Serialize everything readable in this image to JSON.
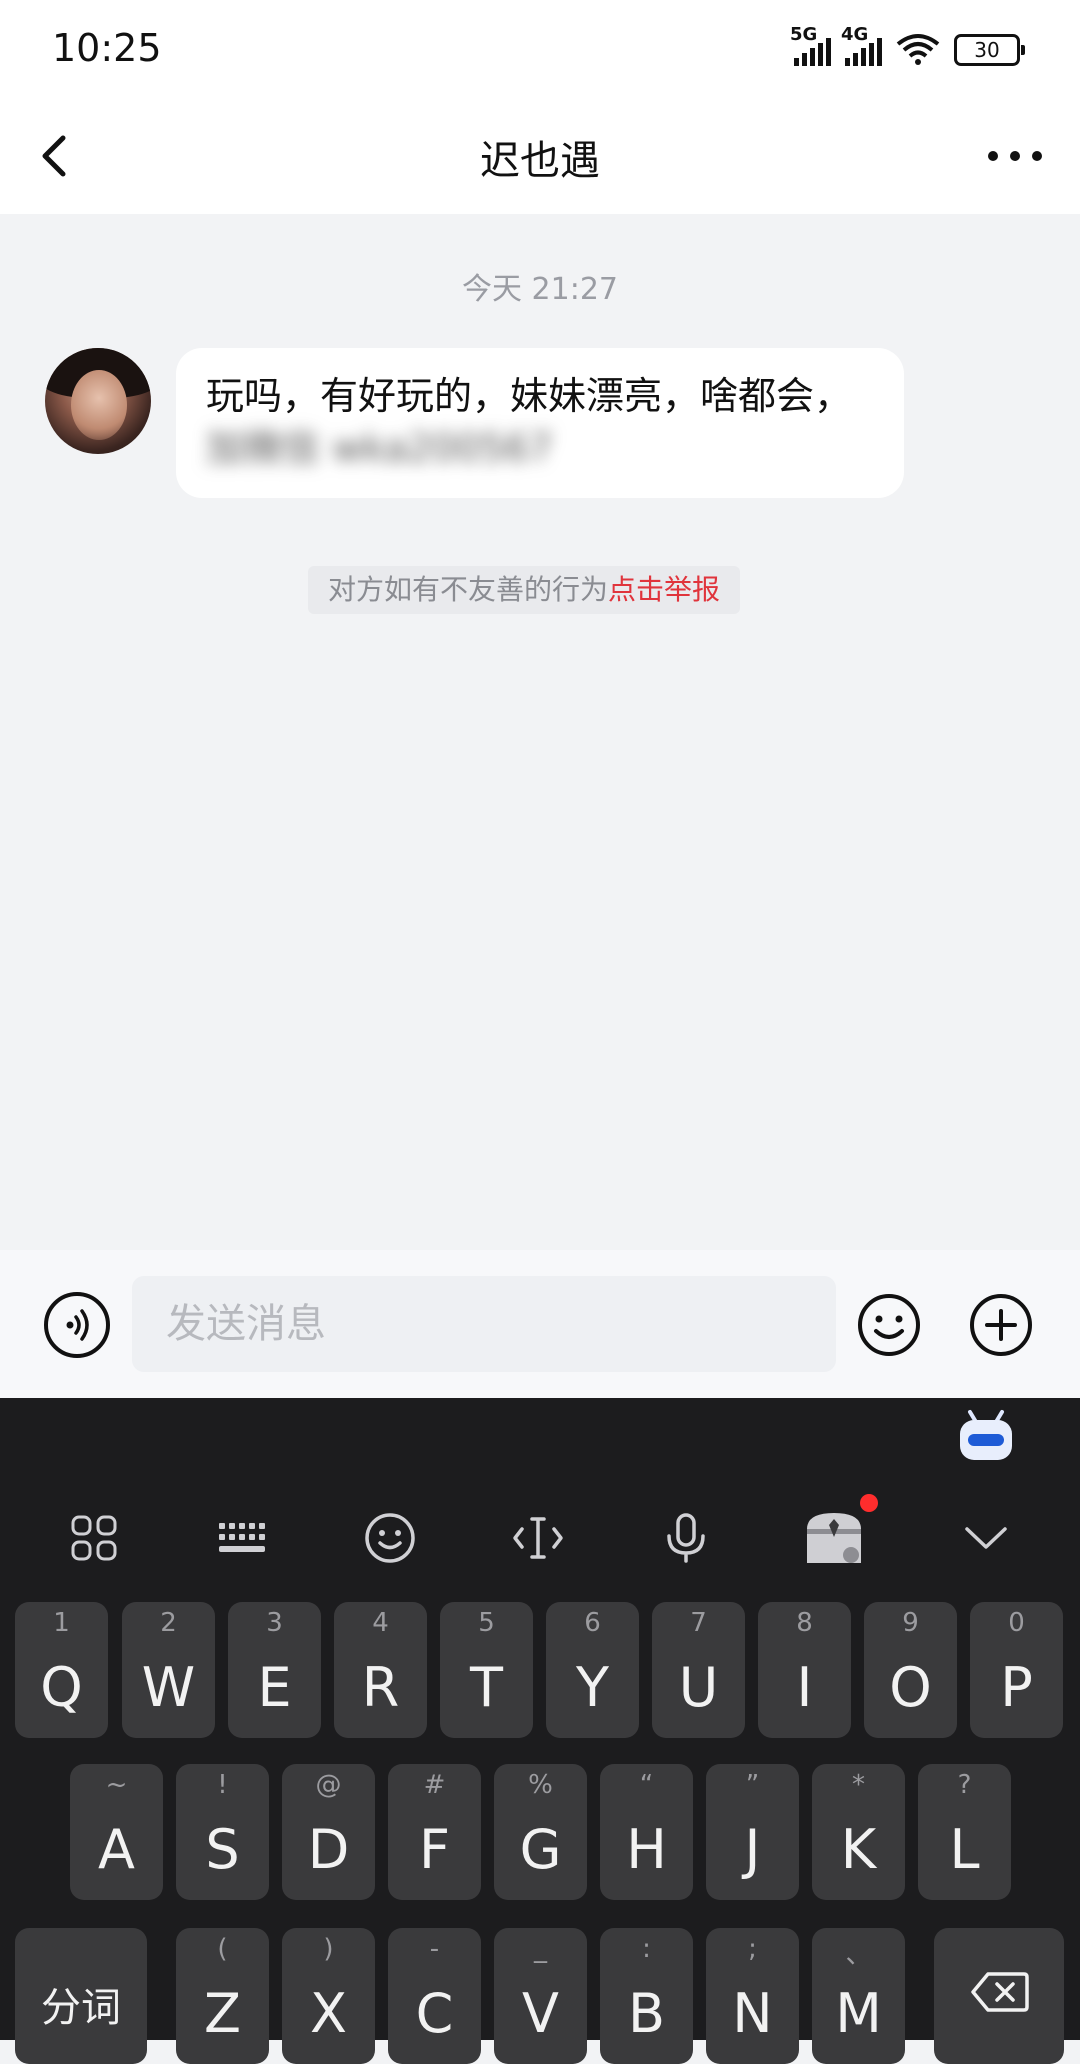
{
  "status_bar": {
    "time": "10:25",
    "network_1": "5G",
    "network_2": "4G",
    "battery": "30"
  },
  "nav": {
    "title": "迟也遇",
    "back_icon": "chevron-left-icon",
    "more_icon": "more-horizontal-icon"
  },
  "chat": {
    "timestamp": "今天 21:27",
    "message_text": "玩吗，有好玩的，妹妹漂亮，啥都会，",
    "message_blurred_part": "加微信 wka200567",
    "report_notice": "对方如有不友善的行为",
    "report_link": "点击举报"
  },
  "input_bar": {
    "placeholder": "发送消息",
    "voice_icon": "voice-icon",
    "emoji_icon": "emoji-icon",
    "plus_icon": "plus-circle-icon"
  },
  "keyboard": {
    "toolbar": [
      "apps-grid-icon",
      "keyboard-icon",
      "emoji-icon",
      "cursor-icon",
      "microphone-icon",
      "treasure-chest-icon",
      "chevron-down-icon"
    ],
    "row1": [
      {
        "main": "Q",
        "sub": "1"
      },
      {
        "main": "W",
        "sub": "2"
      },
      {
        "main": "E",
        "sub": "3"
      },
      {
        "main": "R",
        "sub": "4"
      },
      {
        "main": "T",
        "sub": "5"
      },
      {
        "main": "Y",
        "sub": "6"
      },
      {
        "main": "U",
        "sub": "7"
      },
      {
        "main": "I",
        "sub": "8"
      },
      {
        "main": "O",
        "sub": "9"
      },
      {
        "main": "P",
        "sub": "0"
      }
    ],
    "row2": [
      {
        "main": "A",
        "sub": "~"
      },
      {
        "main": "S",
        "sub": "!"
      },
      {
        "main": "D",
        "sub": "@"
      },
      {
        "main": "F",
        "sub": "#"
      },
      {
        "main": "G",
        "sub": "%"
      },
      {
        "main": "H",
        "sub": "“"
      },
      {
        "main": "J",
        "sub": "”"
      },
      {
        "main": "K",
        "sub": "*"
      },
      {
        "main": "L",
        "sub": "?"
      }
    ],
    "row3_left": "分词",
    "row3": [
      {
        "main": "Z",
        "sub": "("
      },
      {
        "main": "X",
        "sub": ")"
      },
      {
        "main": "C",
        "sub": "-"
      },
      {
        "main": "V",
        "sub": "_"
      },
      {
        "main": "B",
        "sub": ":"
      },
      {
        "main": "N",
        "sub": ";"
      },
      {
        "main": "M",
        "sub": "、"
      }
    ],
    "backspace_icon": "backspace-icon"
  },
  "colors": {
    "accent_red": "#e0343c",
    "chat_bg": "#f2f3f5",
    "keyboard_bg": "#1c1c1e",
    "key_bg": "#3a3a3c"
  }
}
